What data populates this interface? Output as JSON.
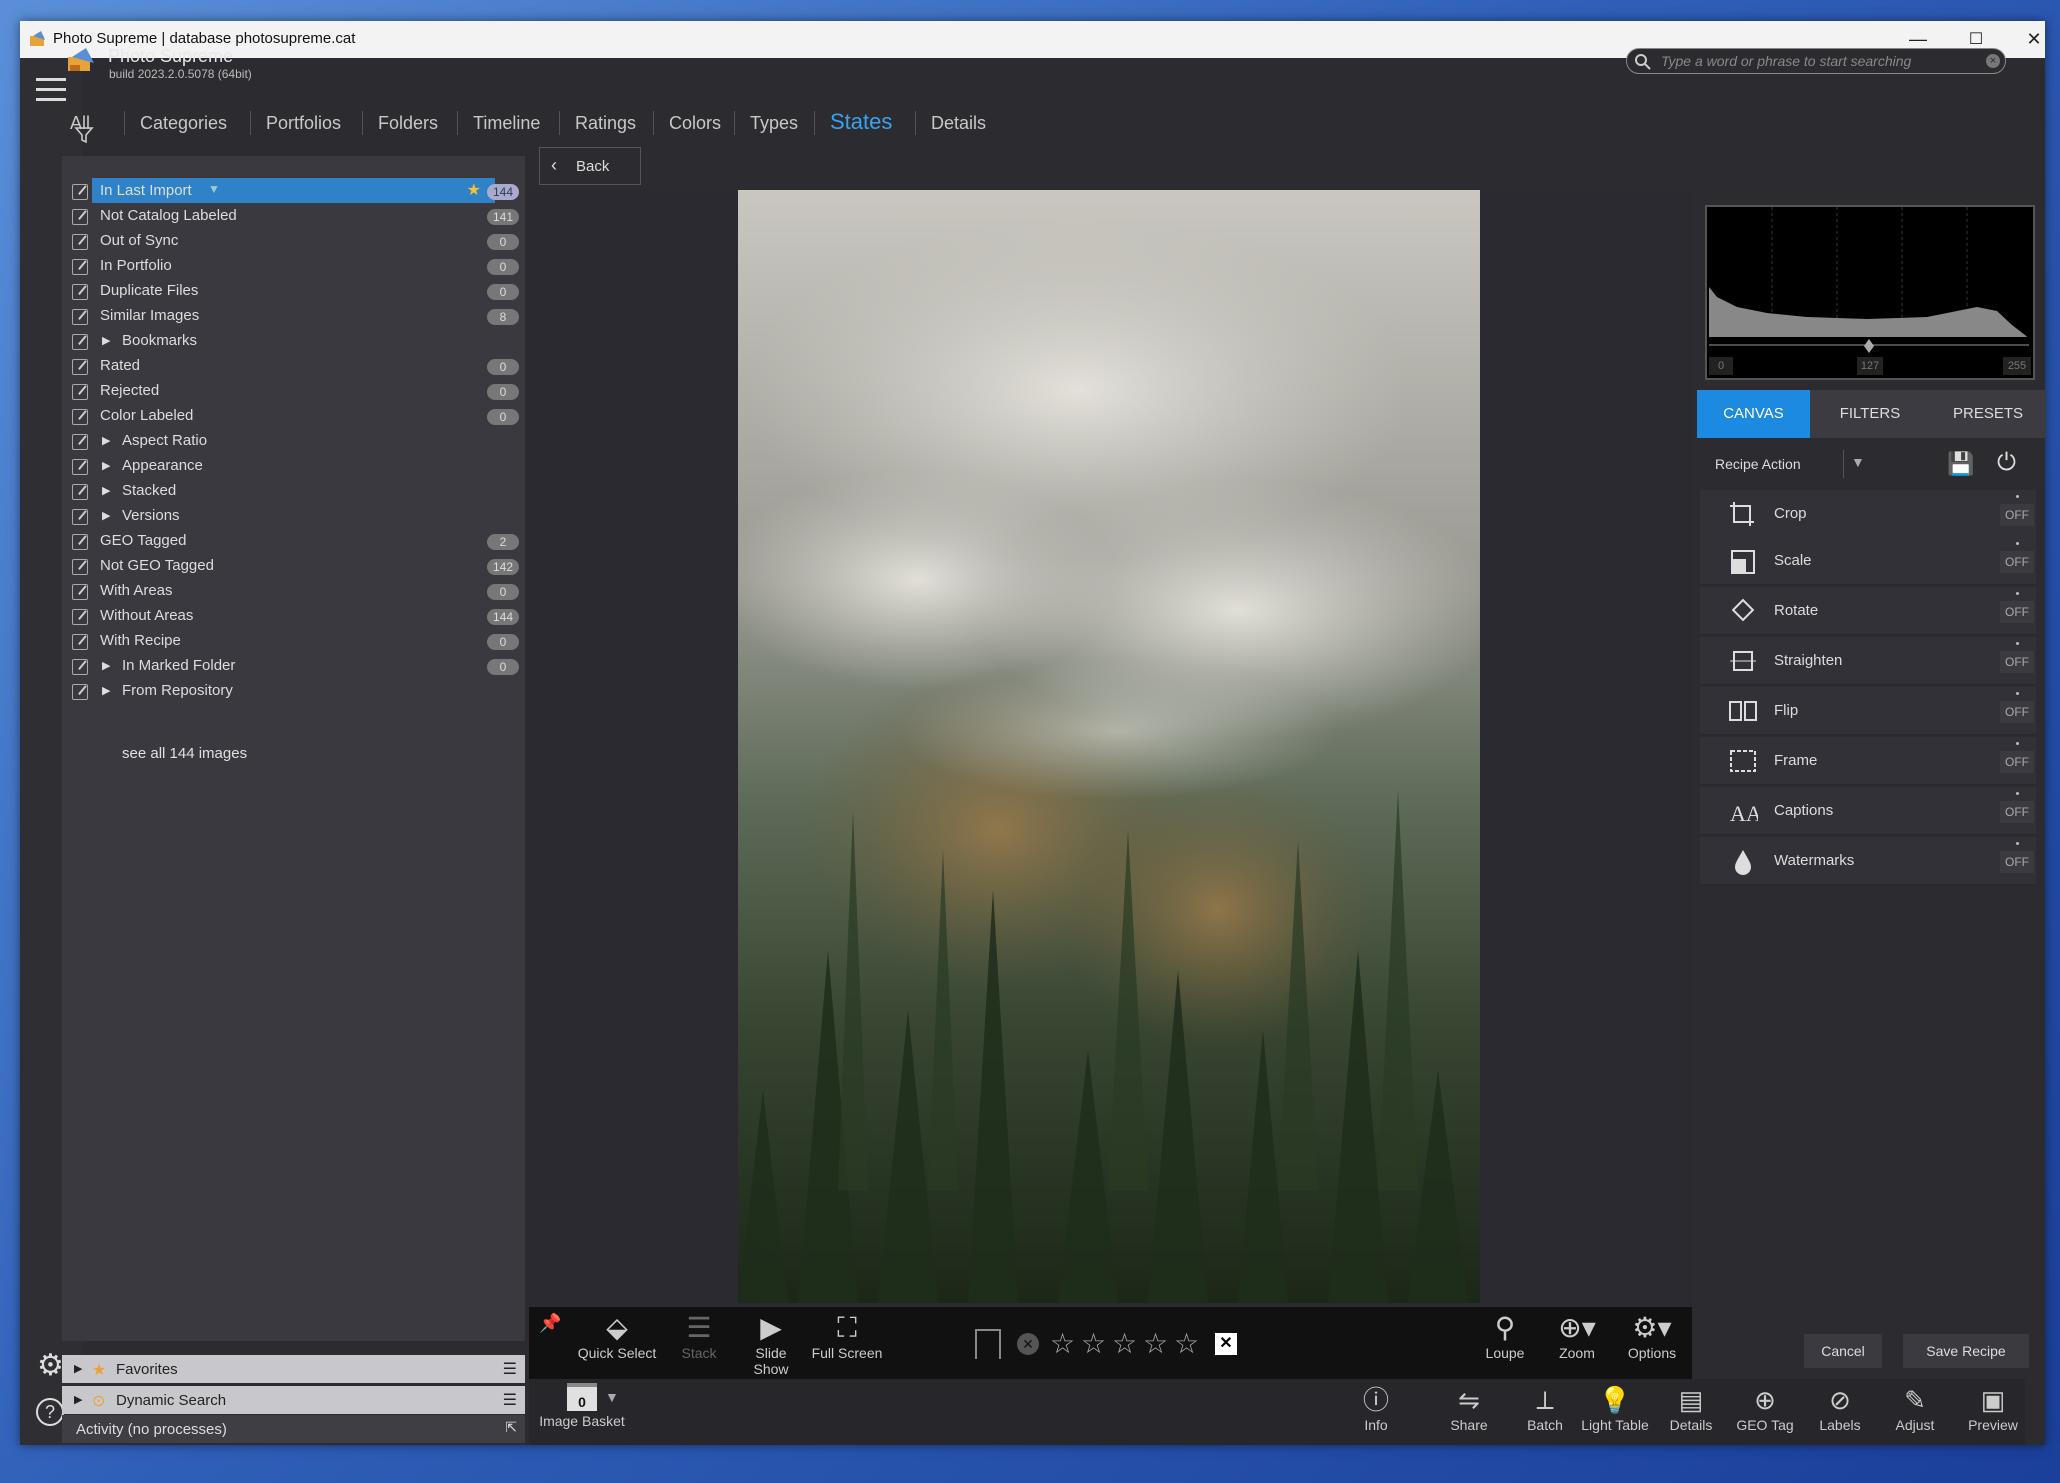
{
  "window": {
    "title": "Photo Supreme | database photosupreme.cat",
    "minimize": "—",
    "maximize": "☐",
    "close": "✕"
  },
  "app": {
    "name": "Photo Supreme",
    "build": "build 2023.2.0.5078 (64bit)"
  },
  "search": {
    "placeholder": "Type a word or phrase to start searching",
    "clear": "×"
  },
  "tabs": [
    "All",
    "Categories",
    "Portfolios",
    "Folders",
    "Timeline",
    "Ratings",
    "Colors",
    "Types",
    "States",
    "Details"
  ],
  "active_tab": "States",
  "states": [
    {
      "label": "In Last Import",
      "count": "144",
      "selected": true
    },
    {
      "label": "Not Catalog Labeled",
      "count": "141"
    },
    {
      "label": "Out of Sync",
      "count": "0"
    },
    {
      "label": "In Portfolio",
      "count": "0"
    },
    {
      "label": "Duplicate Files",
      "count": "0"
    },
    {
      "label": "Similar Images",
      "count": "8"
    },
    {
      "label": "Bookmarks",
      "expandable": true
    },
    {
      "label": "Rated",
      "count": "0"
    },
    {
      "label": "Rejected",
      "count": "0"
    },
    {
      "label": "Color Labeled",
      "count": "0"
    },
    {
      "label": "Aspect Ratio",
      "expandable": true
    },
    {
      "label": "Appearance",
      "expandable": true
    },
    {
      "label": "Stacked",
      "expandable": true
    },
    {
      "label": "Versions",
      "expandable": true
    },
    {
      "label": "GEO Tagged",
      "count": "2"
    },
    {
      "label": "Not GEO Tagged",
      "count": "142"
    },
    {
      "label": "With Areas",
      "count": "0"
    },
    {
      "label": "Without Areas",
      "count": "144"
    },
    {
      "label": "With Recipe",
      "count": "0"
    },
    {
      "label": "In Marked Folder",
      "count": "0",
      "expandable": true
    },
    {
      "label": "From Repository",
      "expandable": true
    }
  ],
  "see_all": "see all 144 images",
  "bottom_panels": {
    "favorites": "Favorites",
    "dynamic_search": "Dynamic Search",
    "activity": "Activity (no processes)"
  },
  "back_label": "Back",
  "viewer_toolbar": {
    "quick_select": "Quick Select",
    "stack": "Stack",
    "slide_show": "Slide Show",
    "full_screen": "Full Screen",
    "loupe": "Loupe",
    "zoom": "Zoom",
    "options": "Options"
  },
  "rating": {
    "stars": 5,
    "value": 0
  },
  "image_basket": {
    "label": "Image Basket",
    "count": "0"
  },
  "bottom_toolbar": [
    "Info",
    "Share",
    "Batch",
    "Light Table",
    "Details",
    "GEO Tag",
    "Labels",
    "Adjust",
    "Preview"
  ],
  "histogram": {
    "min": "0",
    "mid": "127",
    "max": "255"
  },
  "right_tabs": [
    "CANVAS",
    "FILTERS",
    "PRESETS"
  ],
  "active_right_tab": "CANVAS",
  "recipe": {
    "label": "Recipe Action"
  },
  "canvas_items": [
    {
      "label": "Crop",
      "state": "OFF"
    },
    {
      "label": "Scale",
      "state": "OFF"
    },
    {
      "label": "Rotate",
      "state": "OFF"
    },
    {
      "label": "Straighten",
      "state": "OFF"
    },
    {
      "label": "Flip",
      "state": "OFF"
    },
    {
      "label": "Frame",
      "state": "OFF"
    },
    {
      "label": "Captions",
      "state": "OFF"
    },
    {
      "label": "Watermarks",
      "state": "OFF"
    }
  ],
  "actions": {
    "cancel": "Cancel",
    "save_recipe": "Save Recipe"
  },
  "colors": {
    "accent": "#3ba2f0",
    "selected_row": "#2f82c8",
    "panel_bg": "#39393f",
    "window_bg": "#2b2b30"
  }
}
